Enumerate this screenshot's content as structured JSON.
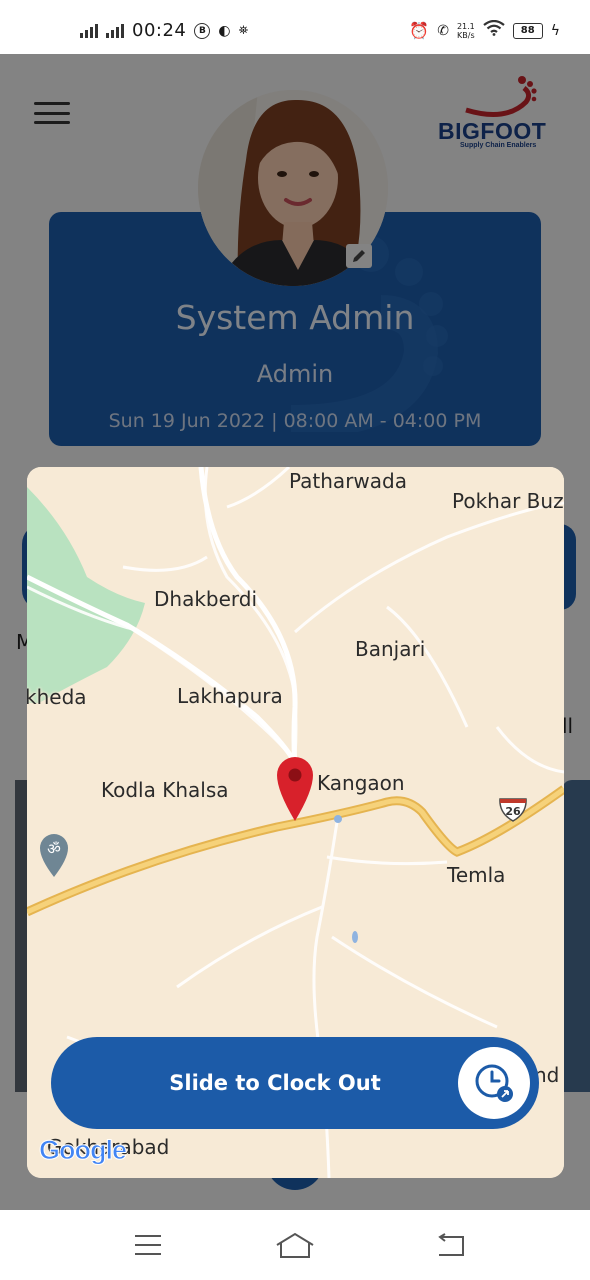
{
  "status_bar": {
    "time": "00:24",
    "network_speed_value": "21.1",
    "network_speed_unit": "KB/s",
    "battery": "88",
    "icons": [
      "signal-icon",
      "signal-icon",
      "b-icon",
      "moon-icon",
      "app-icon",
      "alarm-icon",
      "volte-icon",
      "wifi-icon",
      "battery-icon",
      "charging-icon"
    ]
  },
  "header": {
    "logo_text": "BIGFOOT",
    "logo_tagline": "Supply Chain Enablers"
  },
  "profile": {
    "name": "System Admin",
    "role": "Admin",
    "shift": "Sun 19 Jun 2022 | 08:00 AM - 04:00 PM"
  },
  "background_peek": {
    "left_letter": "M",
    "right_glyph": "ll"
  },
  "map": {
    "places": [
      "Patharwada",
      "Pokhar Buz",
      "Dhakberdi",
      "Banjari",
      "kheda",
      "Lakhapura",
      "Kodla Khalsa",
      "Kangaon",
      "Temla",
      "Gokharabad",
      "nd"
    ],
    "highway_number": "26",
    "attribution": "Google",
    "colors": {
      "land": "#f7ead6",
      "forest": "#b9e2c0",
      "highway": "#f2c75c",
      "pin": "#d8212b"
    }
  },
  "clock_action": {
    "label": "Slide to Clock Out",
    "color": "#1c5ba8"
  },
  "nav": {
    "items": [
      "menu-icon",
      "home-icon",
      "back-icon"
    ]
  }
}
